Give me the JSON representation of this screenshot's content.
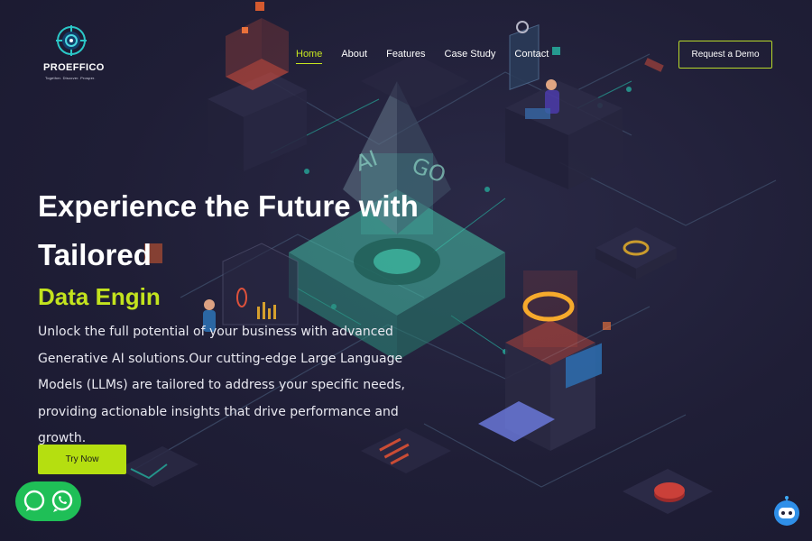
{
  "brand": {
    "name": "PROEFFICO",
    "tagline": "Together. Discover. Prosper.",
    "logo_icon": "target-logo-icon"
  },
  "nav": {
    "items": [
      {
        "label": "Home",
        "active": true
      },
      {
        "label": "About",
        "active": false
      },
      {
        "label": "Features",
        "active": false
      },
      {
        "label": "Case Study",
        "active": false
      },
      {
        "label": "Contact",
        "active": false
      }
    ]
  },
  "header": {
    "demo_button": "Request a Demo"
  },
  "hero": {
    "title_line1": "Experience the Future with",
    "title_line2": "Tailored",
    "accent": "Data Engin",
    "description": "Unlock the full potential of your business with advanced Generative AI solutions.Our cutting-edge Large Language Models (LLMs) are tailored to address your specific needs, providing actionable insights that drive performance and growth.",
    "cta": "Try Now"
  },
  "illustration": {
    "pyramid_text_left": "AI",
    "pyramid_text_right": "GO"
  },
  "widgets": {
    "chat_icons": [
      "chat-bubble-icon",
      "whatsapp-icon"
    ],
    "bot_icon": "chatbot-icon"
  },
  "colors": {
    "accent": "#c3e31e",
    "button": "#b5df10",
    "background": "#1e1d33",
    "whatsapp": "#1fbf57",
    "teal": "#2fa394",
    "orange": "#ff5a3c"
  }
}
